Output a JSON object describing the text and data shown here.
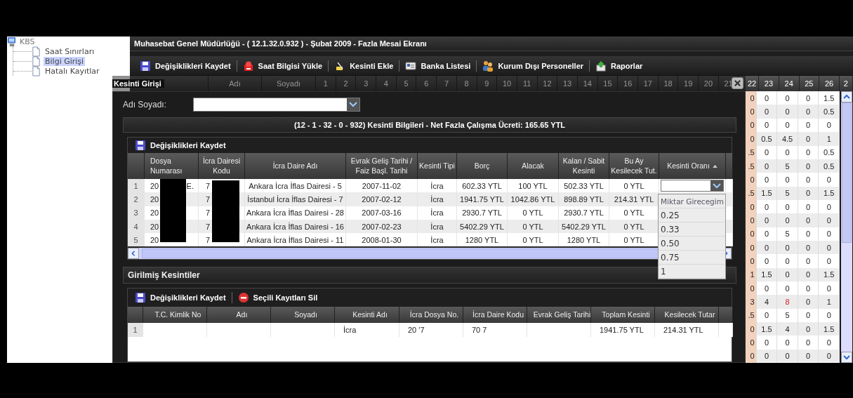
{
  "sidebar": {
    "tree": [
      {
        "label": "KBS",
        "children": [
          {
            "label": "Saat Sınırları",
            "selected": false
          },
          {
            "label": "Bilgi Girişi",
            "selected": true
          },
          {
            "label": "Hatalı Kayıtlar",
            "selected": false
          }
        ]
      }
    ]
  },
  "main": {
    "title": "Muhasebat Genel Müdürlüğü - ( 12.1.32.0.932 ) - Şubat 2009 - Fazla Mesai Ekranı",
    "toolbar": [
      {
        "label": "Değişiklikleri Kaydet",
        "kind": "save"
      },
      {
        "label": "Saat Bilgisi Yükle",
        "kind": "upload"
      },
      {
        "label": "Kesinti Ekle",
        "kind": "eraser"
      },
      {
        "label": "Banka Listesi",
        "kind": "card"
      },
      {
        "label": "Kurum Dışı Personeller",
        "kind": "people"
      },
      {
        "label": "Raporlar",
        "kind": "report"
      }
    ],
    "grid": {
      "columns": [
        "Adı",
        "Soyadı",
        "1",
        "2",
        "3",
        "4",
        "5",
        "6",
        "7",
        "8",
        "9",
        "10",
        "11",
        "12",
        "13",
        "14",
        "15",
        "16",
        "17",
        "18",
        "19",
        "20",
        "21",
        "22",
        "23",
        "24",
        "25",
        "26",
        "2"
      ],
      "rows": [
        {
          "cells": [
            "0",
            "0",
            "0",
            "0",
            "1.5"
          ],
          "alerts": [
            false,
            false,
            false,
            false,
            false
          ]
        },
        {
          "cells": [
            "0",
            "0",
            "0",
            "0",
            "0.5"
          ],
          "alerts": [
            false,
            false,
            false,
            false,
            false
          ]
        },
        {
          "cells": [
            "0",
            "0",
            "0",
            "0",
            "0"
          ],
          "alerts": [
            false,
            false,
            false,
            false,
            false
          ]
        },
        {
          "cells": [
            "0",
            "0.5",
            "4.5",
            "0",
            "1"
          ],
          "alerts": [
            false,
            false,
            false,
            false,
            false
          ]
        },
        {
          "cells": [
            ".5",
            "0",
            "0",
            "0",
            "0.5"
          ],
          "alerts": [
            false,
            false,
            false,
            false,
            false
          ]
        },
        {
          "cells": [
            ".5",
            "0",
            "5",
            "0",
            "0.5"
          ],
          "alerts": [
            false,
            false,
            false,
            false,
            false
          ]
        },
        {
          "cells": [
            "0",
            "0",
            "0",
            "0",
            "0"
          ],
          "alerts": [
            false,
            false,
            false,
            false,
            false
          ]
        },
        {
          "cells": [
            ".5",
            "1.5",
            "5",
            "0",
            "1.5"
          ],
          "alerts": [
            false,
            false,
            false,
            false,
            false
          ]
        },
        {
          "cells": [
            "0",
            "0",
            "0",
            "0",
            "0"
          ],
          "alerts": [
            false,
            false,
            false,
            false,
            false
          ]
        },
        {
          "cells": [
            "0",
            "0",
            "0",
            "0",
            "0"
          ],
          "alerts": [
            false,
            false,
            false,
            false,
            false
          ]
        },
        {
          "cells": [
            "0",
            "0",
            "5",
            "0",
            "0"
          ],
          "alerts": [
            false,
            false,
            false,
            false,
            false
          ]
        },
        {
          "cells": [
            "0",
            "0",
            "0",
            "0",
            "0"
          ],
          "alerts": [
            false,
            false,
            false,
            false,
            false
          ]
        },
        {
          "cells": [
            "0",
            "0",
            "0",
            "0",
            "0"
          ],
          "alerts": [
            false,
            false,
            false,
            false,
            false
          ]
        },
        {
          "cells": [
            "1",
            "1.5",
            "0",
            "0",
            "1.5"
          ],
          "alerts": [
            false,
            false,
            false,
            false,
            false
          ]
        },
        {
          "cells": [
            "0",
            "0",
            "0",
            "0",
            "0"
          ],
          "alerts": [
            false,
            false,
            false,
            false,
            false
          ]
        },
        {
          "cells": [
            "3",
            "4",
            "8",
            "0",
            "1"
          ],
          "alerts": [
            false,
            false,
            true,
            false,
            false
          ]
        },
        {
          "cells": [
            ".5",
            "0",
            "5",
            "0",
            "0"
          ],
          "alerts": [
            false,
            false,
            false,
            false,
            false
          ]
        },
        {
          "cells": [
            "0",
            "1.5",
            "4",
            "0",
            "1.5"
          ],
          "alerts": [
            false,
            false,
            false,
            false,
            false
          ]
        },
        {
          "cells": [
            "0",
            "0",
            "0",
            "0",
            "0"
          ],
          "alerts": [
            false,
            false,
            false,
            false,
            false
          ]
        },
        {
          "cells": [
            "0",
            "0",
            "0",
            "0",
            "0"
          ],
          "alerts": [
            false,
            false,
            false,
            false,
            false
          ]
        }
      ]
    }
  },
  "dialog": {
    "title": "Kesinti Girişi",
    "name_label": "Adı Soyadı:",
    "panel_title": "(12 - 1 - 32 - 0 - 932) Kesinti Bilgileri - Net Fazla Çalışma Ücreti: 165.65 YTL",
    "deductions": {
      "toolbar": [
        {
          "label": "Değişiklikleri Kaydet",
          "kind": "save"
        }
      ],
      "columns": [
        {
          "label": "Dosya Numarası",
          "sorted": false
        },
        {
          "label": "İcra Dairesi Kodu",
          "sorted": false
        },
        {
          "label": "İcra Daire Adı",
          "sorted": false
        },
        {
          "label": "Evrak Geliş Tarihi / Faiz Başl. Tarihi",
          "sorted": false
        },
        {
          "label": "Kesinti Tipi",
          "sorted": false
        },
        {
          "label": "Borç",
          "sorted": false
        },
        {
          "label": "Alacak",
          "sorted": false
        },
        {
          "label": "Kalan / Sabit Kesinti",
          "sorted": false
        },
        {
          "label": "Bu Ay Kesilecek Tut.",
          "sorted": false
        },
        {
          "label": "Kesinti Oranı",
          "sorted": true
        }
      ],
      "rows": [
        {
          "row_number": "1",
          "cells": [
            "20",
            "7",
            "Ankara İcra İflas Dairesi - 5",
            "2007-11-02",
            "İcra",
            "602.33 YTL",
            "100 YTL",
            "502.33 YTL",
            "0 YTL"
          ],
          "dosya_tail": "E.",
          "editing": true
        },
        {
          "row_number": "2",
          "cells": [
            "20",
            "7",
            "İstanbul İcra İflas Dairesi - 7",
            "2007-02-12",
            "İcra",
            "1941.75 YTL",
            "1042.86 YTL",
            "898.89 YTL",
            "214.31 YTL"
          ],
          "editing": false
        },
        {
          "row_number": "3",
          "cells": [
            "20",
            "7",
            "Ankara İcra İflas Dairesi - 28",
            "2007-03-16",
            "İcra",
            "2930.7 YTL",
            "0 YTL",
            "2930.7 YTL",
            "0 YTL"
          ],
          "editing": false
        },
        {
          "row_number": "4",
          "cells": [
            "20",
            "7",
            "Ankara İcra İflas Dairesi - 16",
            "2007-02-23",
            "İcra",
            "5402.29 YTL",
            "0 YTL",
            "5402.29 YTL",
            "0 YTL"
          ],
          "editing": false
        },
        {
          "row_number": "5",
          "cells": [
            "20",
            "7",
            "Ankara İcra İflas Dairesi - 11",
            "2008-01-30",
            "İcra",
            "1280 YTL",
            "0 YTL",
            "1280 YTL",
            "0 YTL"
          ],
          "editing": false
        }
      ],
      "options": [
        "Miktar Girecegim",
        "0.25",
        "0.33",
        "0.50",
        "0.75",
        "1"
      ]
    },
    "entered": {
      "title": "Girilmiş Kesintiler",
      "toolbar": [
        {
          "label": "Değişiklikleri Kaydet",
          "kind": "save"
        },
        {
          "label": "Seçili Kayıtları Sil",
          "kind": "delete"
        }
      ],
      "columns": [
        "T.C. Kimlik No",
        "Adı",
        "Soyadı",
        "Kesinti Adı",
        "İcra Dosya No.",
        "İcra Daire Kodu",
        "Evrak Geliş Tarihi",
        "Toplam Kesinti",
        "Kesilecek Tutar"
      ],
      "rows": [
        {
          "row_number": "1",
          "cells": [
            null,
            null,
            null,
            "İcra",
            "20 '7",
            "70 7",
            null,
            "1941.75 YTL",
            "214.31 YTL"
          ]
        }
      ]
    }
  }
}
